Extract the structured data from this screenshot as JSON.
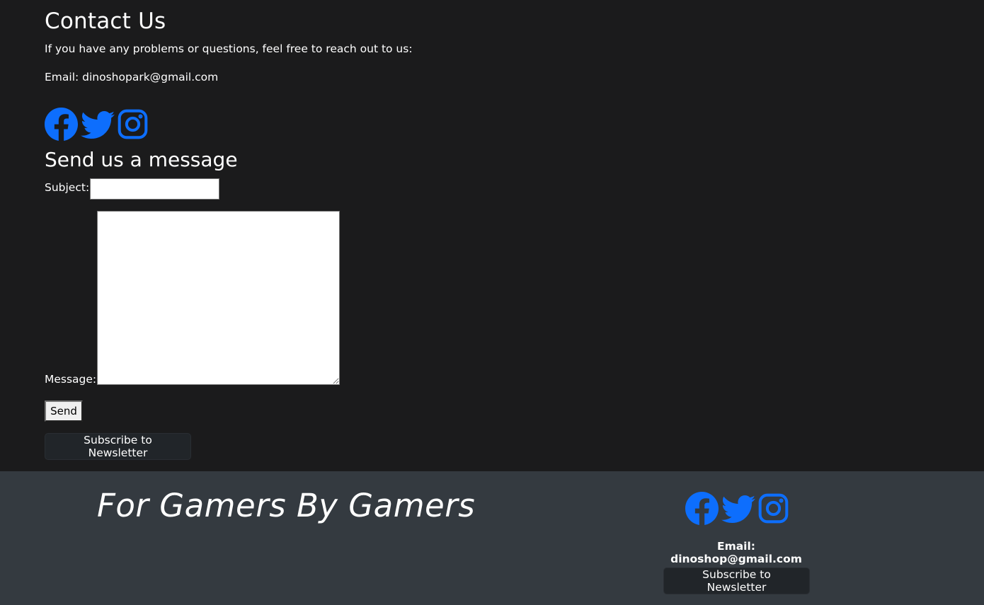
{
  "contact": {
    "title": "Contact Us",
    "intro": "If you have any problems or questions, feel free to reach out to us:",
    "email_line": "Email: dinoshopark@gmail.com"
  },
  "social": {
    "icons": [
      "facebook-icon",
      "twitter-icon",
      "instagram-icon"
    ],
    "icon_color": "#0d6efd"
  },
  "form": {
    "title": "Send us a message",
    "subject_label": "Subject:",
    "subject_value": "",
    "message_label": "Message:",
    "message_value": "",
    "send_label": "Send"
  },
  "newsletter": {
    "label": "Subscribe to Newsletter"
  },
  "footer": {
    "tagline": "For Gamers By Gamers",
    "email": "Email: dinoshop@gmail.com",
    "newsletter_label": "Subscribe to Newsletter",
    "background": "#343a40"
  },
  "colors": {
    "page_background": "#1b1b1c",
    "accent": "#0d6efd",
    "button_dark": "#212529"
  }
}
